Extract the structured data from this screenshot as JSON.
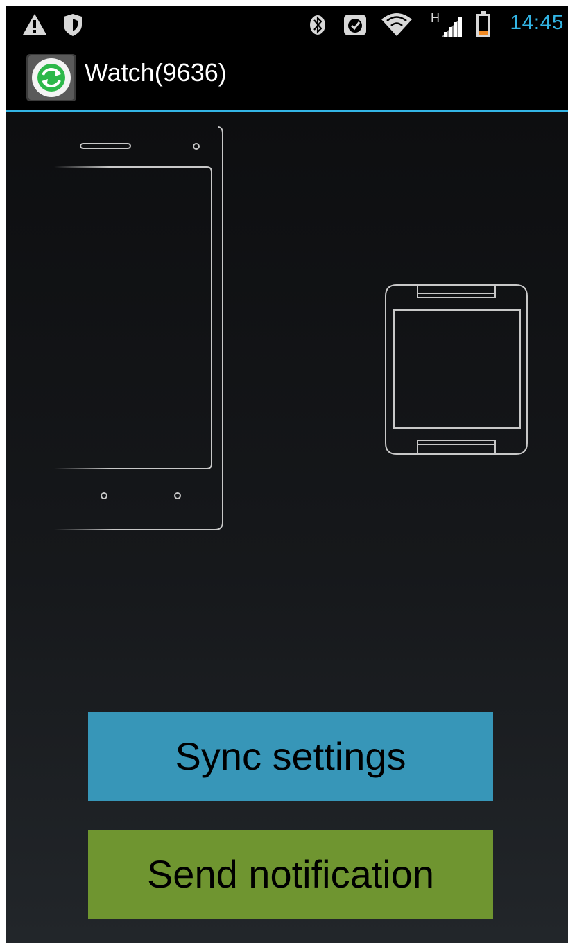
{
  "status_bar": {
    "time": "14:45",
    "icons": [
      "warning-icon",
      "shield-icon",
      "bluetooth-icon",
      "alarm-icon",
      "wifi-icon",
      "signal-h-icon",
      "battery-low-icon"
    ],
    "time_color": "#33b5e5"
  },
  "action_bar": {
    "title": "Watch(9636)",
    "icon": "sync-app-icon",
    "divider_color": "#33b5e5"
  },
  "illustration": {
    "items": [
      "phone-outline-icon",
      "watch-outline-icon"
    ]
  },
  "buttons": {
    "sync_label": "Sync settings",
    "sync_color": "#3796b8",
    "notify_label": "Send notification",
    "notify_color": "#6f9530"
  }
}
